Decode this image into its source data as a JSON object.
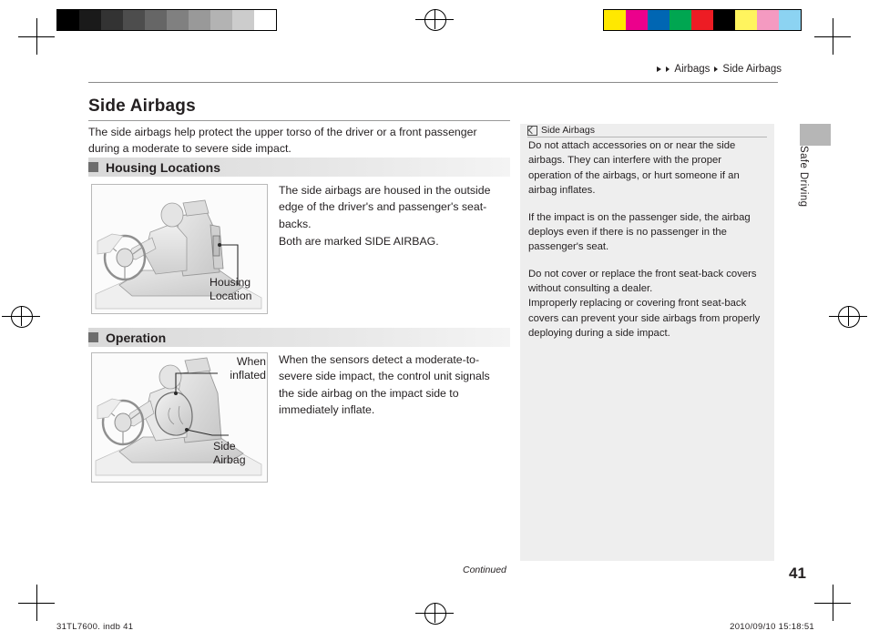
{
  "registration": {
    "grayscale_swatches": [
      "#000000",
      "#1a1a1a",
      "#333333",
      "#4d4d4d",
      "#666666",
      "#808080",
      "#999999",
      "#b3b3b3",
      "#cccccc",
      "#ffffff"
    ],
    "color_swatches": [
      "#ffe800",
      "#ec008c",
      "#0066b3",
      "#00a651",
      "#ed1c24",
      "#000000",
      "#fff45e",
      "#f49ac1",
      "#8cd3f2"
    ]
  },
  "breadcrumb": {
    "section": "Airbags",
    "page": "Side Airbags"
  },
  "header": {
    "title": "Side Airbags",
    "intro": "The side airbags help protect the upper torso of the driver or a front passenger during a moderate to severe side impact."
  },
  "sections": [
    {
      "id": "housing",
      "label": "Housing Locations",
      "paragraphs": [
        "The side airbags are housed in the outside edge of the driver's and passenger's seat-backs.",
        "Both are marked SIDE AIRBAG."
      ],
      "callouts": [
        "Housing Location"
      ]
    },
    {
      "id": "operation",
      "label": "Operation",
      "paragraphs": [
        "When the sensors detect a moderate-to-severe side impact, the control unit signals the side airbag on the impact side to immediately inflate."
      ],
      "callouts": [
        "When inflated",
        "Side Airbag"
      ]
    }
  ],
  "notice": {
    "icon": "notice-icon",
    "title": "Side Airbags",
    "paragraphs": [
      "Do not attach accessories on or near the side airbags. They can interfere with the proper operation of the airbags, or hurt someone if an airbag inflates.",
      "If the impact is on the passenger side, the airbag deploys even if there is no passenger in the passenger's seat.",
      "Do not cover or replace the front seat-back covers without consulting a dealer.",
      "Improperly replacing or covering front seat-back covers can prevent your side airbags from properly deploying during a side impact."
    ]
  },
  "side_tab": {
    "label": "Safe Driving"
  },
  "footer": {
    "continued": "Continued",
    "page_number": "41",
    "file_info": "31TL7600. indb   41",
    "timestamp": "2010/09/10   15:18:51"
  }
}
